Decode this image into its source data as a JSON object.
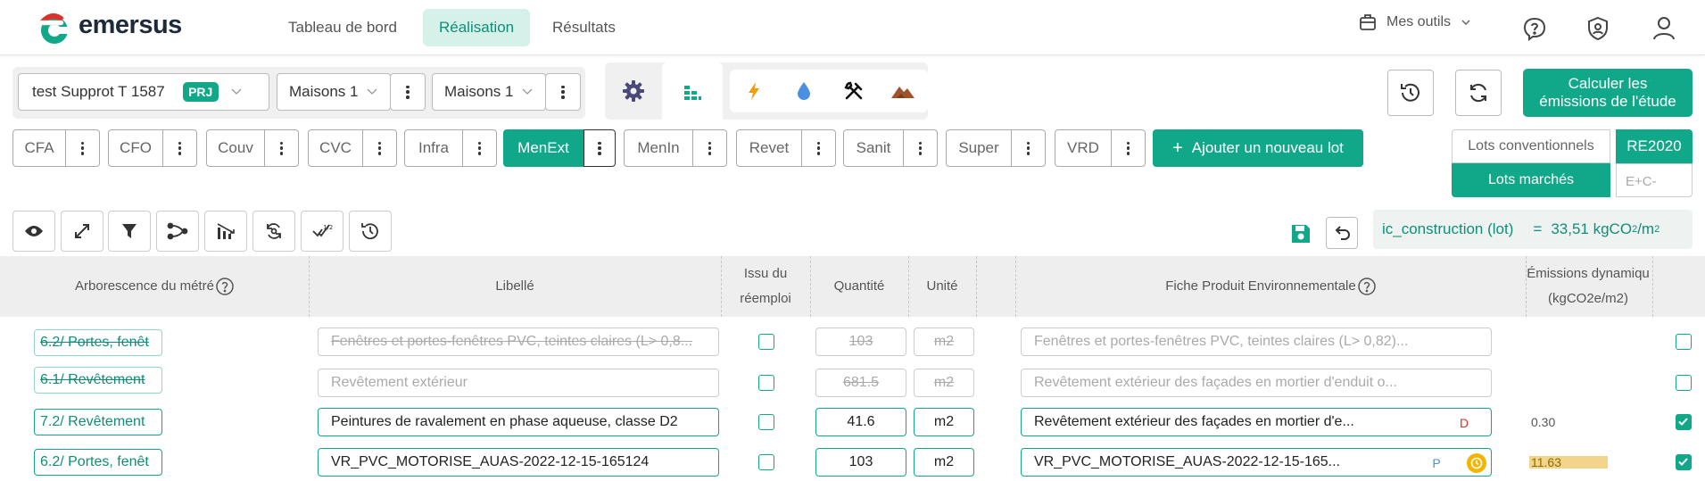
{
  "brand": {
    "name": "emersus",
    "accent": "#11a88a",
    "accent_dark": "#0f8f75"
  },
  "nav": {
    "links": [
      {
        "label": "Tableau de bord"
      },
      {
        "label": "Réalisation"
      },
      {
        "label": "Résultats"
      }
    ],
    "tools_label": "Mes outils"
  },
  "project": {
    "name": "test Supprot T 1587",
    "badge": "PRJ",
    "selector1": "Maisons 1",
    "selector2": "Maisons 1"
  },
  "calc_button": {
    "line1": "Calculer les",
    "line2": "émissions de l'étude"
  },
  "lots": [
    {
      "label": "CFA"
    },
    {
      "label": "CFO"
    },
    {
      "label": "Couv"
    },
    {
      "label": "CVC"
    },
    {
      "label": "Infra"
    },
    {
      "label": "MenExt"
    },
    {
      "label": "MenIn"
    },
    {
      "label": "Revet"
    },
    {
      "label": "Sanit"
    },
    {
      "label": "Super"
    },
    {
      "label": "VRD"
    }
  ],
  "add_lot_label": "Ajouter un nouveau lot",
  "segmented": {
    "conventional": "Lots conventionnels",
    "markets": "Lots marchés",
    "re2020": "RE2020",
    "ec": "E+C-"
  },
  "indicator": {
    "name": "ic_construction (lot)",
    "equals": "=",
    "value": "33,51 kgCO",
    "sub": "2",
    "unit": "/m",
    "sup": "2"
  },
  "table": {
    "headers": {
      "tree": "Arborescence du métré",
      "label": "Libellé",
      "reuse_line1": "Issu du",
      "reuse_line2": "réemploi",
      "quantity": "Quantité",
      "unit": "Unité",
      "fpe": "Fiche Produit Environnementale",
      "emissions_line1": "Émissions dynamiqu",
      "emissions_line2": "(kgCO2e/m2)"
    },
    "rows": [
      {
        "tag": "6.2/ Portes, fenêt",
        "label": "Fenêtres et portes-fenêtres PVC, teintes claires (L> 0,8...",
        "quantity": "103",
        "unit": "m2",
        "fpe": "Fenêtres et portes-fenêtres PVC, teintes claires (L> 0,82)...",
        "fpe_badge": "",
        "emission": "",
        "selected": false
      },
      {
        "tag": "6.1/ Revêtement",
        "label": "Revêtement extérieur",
        "quantity": "681.5",
        "unit": "m2",
        "fpe": "Revêtement extérieur des façades en mortier d'enduit o...",
        "fpe_badge": "",
        "emission": "",
        "selected": false
      },
      {
        "tag": "7.2/ Revêtement",
        "label": "Peintures de ravalement en phase aqueuse, classe D2",
        "quantity": "41.6",
        "unit": "m2",
        "fpe": "Revêtement extérieur des façades en mortier d'e...",
        "fpe_badge": "D",
        "emission": "0.30",
        "selected": true
      },
      {
        "tag": "6.2/ Portes, fenêt",
        "label": "VR_PVC_MOTORISE_AUAS-2022-12-15-165124",
        "quantity": "103",
        "unit": "m2",
        "fpe": "VR_PVC_MOTORISE_AUAS-2022-12-15-165...",
        "fpe_badge": "P",
        "emission": "11.63",
        "selected": true
      }
    ]
  }
}
